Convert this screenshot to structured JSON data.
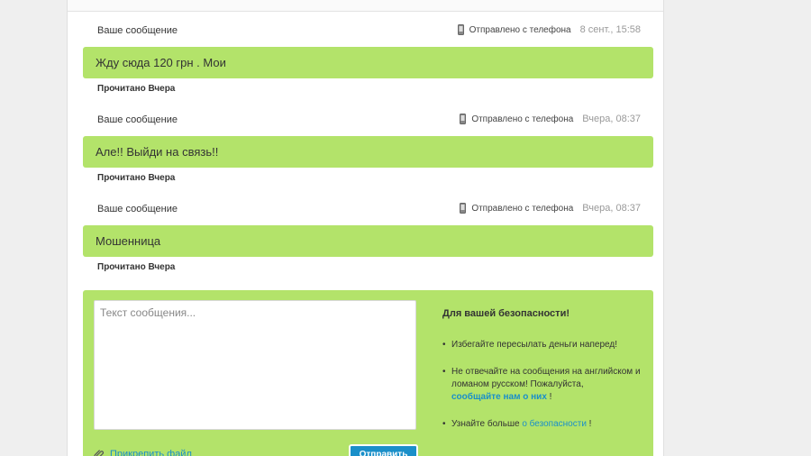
{
  "messages": [
    {
      "label": "Ваше сообщение",
      "sent_via": "Отправлено с телефона",
      "time": "8 сент., 15:58",
      "text": "Жду сюда 120 грн . Мои",
      "read_status": "Прочитано Вчера"
    },
    {
      "label": "Ваше сообщение",
      "sent_via": "Отправлено с телефона",
      "time": "Вчера, 08:37",
      "text": "Але!! Выйди на связь!!",
      "read_status": "Прочитано Вчера"
    },
    {
      "label": "Ваше сообщение",
      "sent_via": "Отправлено с телефона",
      "time": "Вчера, 08:37",
      "text": "Мошенница",
      "read_status": "Прочитано Вчера"
    }
  ],
  "compose": {
    "placeholder": "Текст сообщения...",
    "attach_label": "Прикрепить файл",
    "send_label": "Отправить"
  },
  "safety": {
    "title": "Для вашей безопасности!",
    "tip1": "Избегайте пересылать деньги наперед!",
    "tip2_text": "Не отвечайте на сообщения на английском и ломаном русском! Пожалуйста,",
    "tip2_link": "сообщайте нам о них",
    "tip2_suffix": " !",
    "tip3_text": "Узнайте больше ",
    "tip3_link": "о безопасности",
    "tip3_suffix": " !"
  },
  "colors": {
    "bubble": "#b3e36a",
    "link": "#1a8fc9",
    "button": "#1a8fc9"
  },
  "icons": {
    "phone": "phone-icon",
    "attach": "paperclip-icon"
  }
}
